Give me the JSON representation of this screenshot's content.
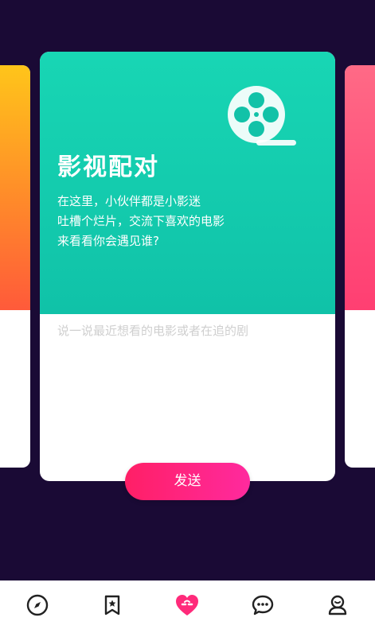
{
  "card": {
    "title": "影视配对",
    "description_lines": [
      "在这里，小伙伴都是小影迷",
      "吐槽个烂片，交流下喜欢的电影",
      "来看看你会遇见谁?"
    ],
    "input_placeholder": "说一说最近想看的电影或者在追的剧",
    "icon": "film-reel-icon"
  },
  "send_button": {
    "label": "发送"
  },
  "bottom_nav": {
    "items": [
      {
        "icon": "compass-icon",
        "active": false
      },
      {
        "icon": "bookmark-star-icon",
        "active": false
      },
      {
        "icon": "heart-link-icon",
        "active": true
      },
      {
        "icon": "chat-bubble-icon",
        "active": false
      },
      {
        "icon": "profile-icon",
        "active": false
      }
    ]
  },
  "colors": {
    "background": "#1a0a35",
    "card_green": "#12c7aa",
    "send_gradient_start": "#ff1f66",
    "send_gradient_end": "#ff2a9e",
    "active_nav": "#ff2a7a"
  }
}
